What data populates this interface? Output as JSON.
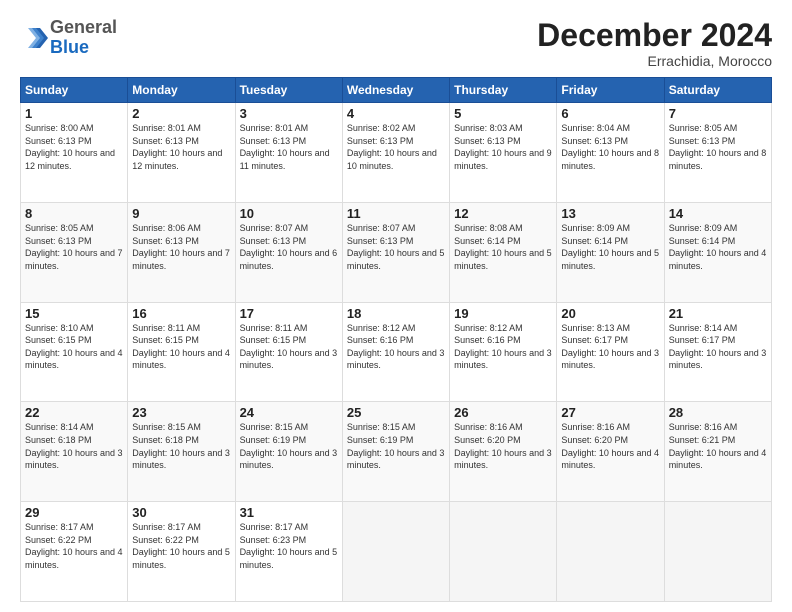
{
  "logo": {
    "general": "General",
    "blue": "Blue"
  },
  "header": {
    "month": "December 2024",
    "location": "Errachidia, Morocco"
  },
  "days": [
    "Sunday",
    "Monday",
    "Tuesday",
    "Wednesday",
    "Thursday",
    "Friday",
    "Saturday"
  ],
  "weeks": [
    [
      {
        "num": "1",
        "sunrise": "8:00 AM",
        "sunset": "6:13 PM",
        "daylight": "10 hours and 12 minutes."
      },
      {
        "num": "2",
        "sunrise": "8:01 AM",
        "sunset": "6:13 PM",
        "daylight": "10 hours and 12 minutes."
      },
      {
        "num": "3",
        "sunrise": "8:01 AM",
        "sunset": "6:13 PM",
        "daylight": "10 hours and 11 minutes."
      },
      {
        "num": "4",
        "sunrise": "8:02 AM",
        "sunset": "6:13 PM",
        "daylight": "10 hours and 10 minutes."
      },
      {
        "num": "5",
        "sunrise": "8:03 AM",
        "sunset": "6:13 PM",
        "daylight": "10 hours and 9 minutes."
      },
      {
        "num": "6",
        "sunrise": "8:04 AM",
        "sunset": "6:13 PM",
        "daylight": "10 hours and 8 minutes."
      },
      {
        "num": "7",
        "sunrise": "8:05 AM",
        "sunset": "6:13 PM",
        "daylight": "10 hours and 8 minutes."
      }
    ],
    [
      {
        "num": "8",
        "sunrise": "8:05 AM",
        "sunset": "6:13 PM",
        "daylight": "10 hours and 7 minutes."
      },
      {
        "num": "9",
        "sunrise": "8:06 AM",
        "sunset": "6:13 PM",
        "daylight": "10 hours and 7 minutes."
      },
      {
        "num": "10",
        "sunrise": "8:07 AM",
        "sunset": "6:13 PM",
        "daylight": "10 hours and 6 minutes."
      },
      {
        "num": "11",
        "sunrise": "8:07 AM",
        "sunset": "6:13 PM",
        "daylight": "10 hours and 5 minutes."
      },
      {
        "num": "12",
        "sunrise": "8:08 AM",
        "sunset": "6:14 PM",
        "daylight": "10 hours and 5 minutes."
      },
      {
        "num": "13",
        "sunrise": "8:09 AM",
        "sunset": "6:14 PM",
        "daylight": "10 hours and 5 minutes."
      },
      {
        "num": "14",
        "sunrise": "8:09 AM",
        "sunset": "6:14 PM",
        "daylight": "10 hours and 4 minutes."
      }
    ],
    [
      {
        "num": "15",
        "sunrise": "8:10 AM",
        "sunset": "6:15 PM",
        "daylight": "10 hours and 4 minutes."
      },
      {
        "num": "16",
        "sunrise": "8:11 AM",
        "sunset": "6:15 PM",
        "daylight": "10 hours and 4 minutes."
      },
      {
        "num": "17",
        "sunrise": "8:11 AM",
        "sunset": "6:15 PM",
        "daylight": "10 hours and 3 minutes."
      },
      {
        "num": "18",
        "sunrise": "8:12 AM",
        "sunset": "6:16 PM",
        "daylight": "10 hours and 3 minutes."
      },
      {
        "num": "19",
        "sunrise": "8:12 AM",
        "sunset": "6:16 PM",
        "daylight": "10 hours and 3 minutes."
      },
      {
        "num": "20",
        "sunrise": "8:13 AM",
        "sunset": "6:17 PM",
        "daylight": "10 hours and 3 minutes."
      },
      {
        "num": "21",
        "sunrise": "8:14 AM",
        "sunset": "6:17 PM",
        "daylight": "10 hours and 3 minutes."
      }
    ],
    [
      {
        "num": "22",
        "sunrise": "8:14 AM",
        "sunset": "6:18 PM",
        "daylight": "10 hours and 3 minutes."
      },
      {
        "num": "23",
        "sunrise": "8:15 AM",
        "sunset": "6:18 PM",
        "daylight": "10 hours and 3 minutes."
      },
      {
        "num": "24",
        "sunrise": "8:15 AM",
        "sunset": "6:19 PM",
        "daylight": "10 hours and 3 minutes."
      },
      {
        "num": "25",
        "sunrise": "8:15 AM",
        "sunset": "6:19 PM",
        "daylight": "10 hours and 3 minutes."
      },
      {
        "num": "26",
        "sunrise": "8:16 AM",
        "sunset": "6:20 PM",
        "daylight": "10 hours and 3 minutes."
      },
      {
        "num": "27",
        "sunrise": "8:16 AM",
        "sunset": "6:20 PM",
        "daylight": "10 hours and 4 minutes."
      },
      {
        "num": "28",
        "sunrise": "8:16 AM",
        "sunset": "6:21 PM",
        "daylight": "10 hours and 4 minutes."
      }
    ],
    [
      {
        "num": "29",
        "sunrise": "8:17 AM",
        "sunset": "6:22 PM",
        "daylight": "10 hours and 4 minutes."
      },
      {
        "num": "30",
        "sunrise": "8:17 AM",
        "sunset": "6:22 PM",
        "daylight": "10 hours and 5 minutes."
      },
      {
        "num": "31",
        "sunrise": "8:17 AM",
        "sunset": "6:23 PM",
        "daylight": "10 hours and 5 minutes."
      },
      null,
      null,
      null,
      null
    ]
  ]
}
